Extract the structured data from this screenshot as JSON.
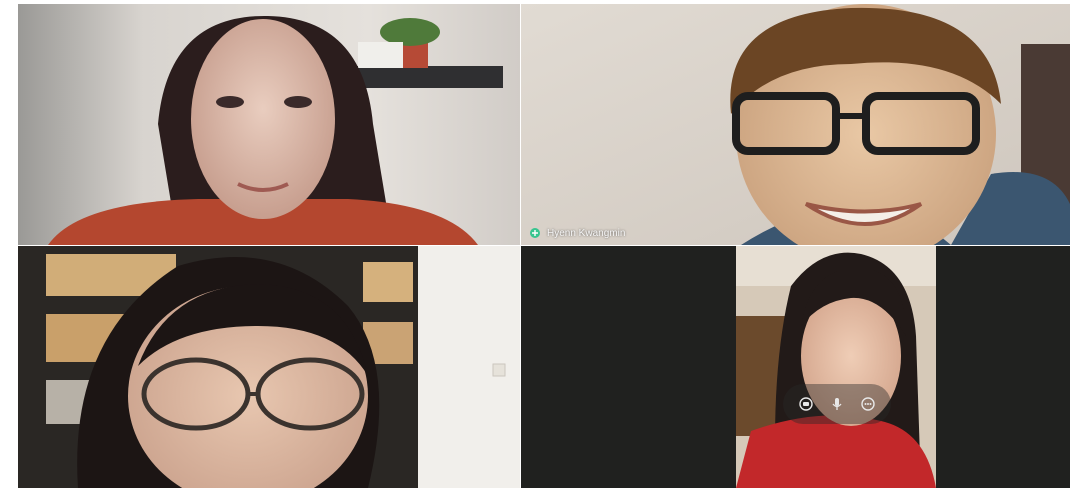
{
  "participants": [
    {
      "id": "p1",
      "label": ""
    },
    {
      "id": "p2",
      "label": "Hyenn Kwangmin"
    },
    {
      "id": "p3",
      "label": ""
    },
    {
      "id": "p4",
      "label": ""
    }
  ],
  "controls": {
    "icons": [
      "camera-off-icon",
      "microphone-icon",
      "more-options-icon"
    ]
  },
  "colors": {
    "self_view_bg": "#20211f",
    "overlay_bg": "rgba(40,40,40,0.42)",
    "pin_accent": "#36c58f"
  }
}
